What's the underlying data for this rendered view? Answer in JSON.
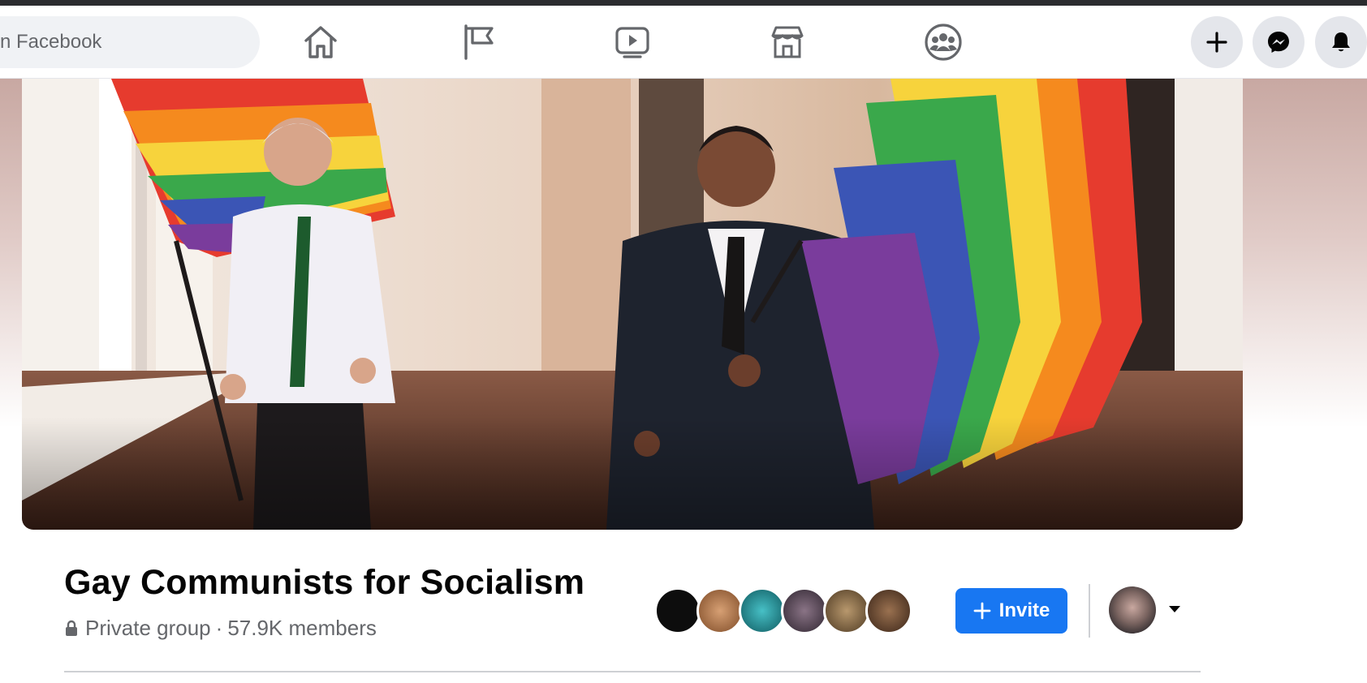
{
  "topbar": {
    "search_placeholder": "n Facebook",
    "nav": [
      {
        "name": "home",
        "icon": "home-icon"
      },
      {
        "name": "pages",
        "icon": "flag-icon"
      },
      {
        "name": "watch",
        "icon": "video-icon"
      },
      {
        "name": "marketplace",
        "icon": "store-icon"
      },
      {
        "name": "groups",
        "icon": "groups-icon"
      }
    ],
    "actions": [
      {
        "name": "create",
        "icon": "plus-icon"
      },
      {
        "name": "messenger",
        "icon": "messenger-icon"
      },
      {
        "name": "notifications",
        "icon": "bell-icon"
      }
    ]
  },
  "cover": {
    "icon": "group-cover-photo",
    "description_colors": [
      "#f2d8c8",
      "#1b1d26",
      "#e8e4ea"
    ]
  },
  "group": {
    "name": "Gay Communists for Socialism",
    "privacy": "Private group",
    "separator": "·",
    "members": "57.9K members",
    "privacy_icon": "lock-icon"
  },
  "member_avatars": [
    "#0d0d0d",
    "#b9814f",
    "#1d8b93",
    "#5b4a58",
    "#8b6b47",
    "#6b4a32"
  ],
  "actions": {
    "invite_label": "Invite",
    "invite_icon": "plus-icon",
    "profile_menu_icon": "caret-down-icon"
  },
  "colors": {
    "accent": "#1877f2",
    "text_primary": "#050505",
    "text_secondary": "#65676b",
    "search_bg": "#f0f2f5",
    "button_bg": "#e4e6eb"
  }
}
